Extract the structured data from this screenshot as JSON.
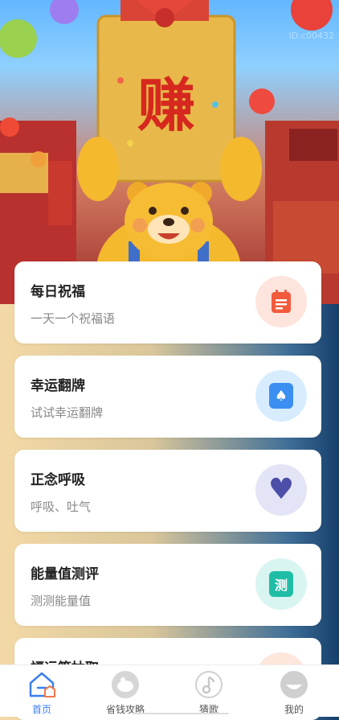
{
  "hero": {
    "banner_char": "赚",
    "watermark": "ID:c00432"
  },
  "cards": [
    {
      "title": "每日祝福",
      "subtitle": "一天一个祝福语",
      "icon": "note-icon",
      "icon_glyph": "",
      "bg": "#fde4dd",
      "fg": "#f15a3c"
    },
    {
      "title": "幸运翻牌",
      "subtitle": "试试幸运翻牌",
      "icon": "card-spade-icon",
      "icon_glyph": "♠",
      "bg": "#d7ecff",
      "fg": "#3b8ff0"
    },
    {
      "title": "正念呼吸",
      "subtitle": "呼吸、吐气",
      "icon": "heart-icon",
      "icon_glyph": "♥",
      "bg": "#e4e4f7",
      "fg": "#4c4fa8"
    },
    {
      "title": "能量值测评",
      "subtitle": "测测能量值",
      "icon": "test-icon",
      "icon_glyph": "测",
      "bg": "#d8f5f1",
      "fg": "#1fbda6"
    },
    {
      "title": "福运签抽取",
      "subtitle": "",
      "icon": "lot-icon",
      "icon_glyph": "",
      "bg": "#fde6dc",
      "fg": "#f07a4c"
    }
  ],
  "tabs": [
    {
      "label": "首页",
      "icon": "home-icon",
      "active": true
    },
    {
      "label": "省钱攻略",
      "icon": "piggy-bank-icon",
      "active": false
    },
    {
      "label": "猜歌",
      "icon": "music-note-icon",
      "active": false
    },
    {
      "label": "我的",
      "icon": "profile-icon",
      "active": false
    }
  ],
  "colors": {
    "active_tab": "#3b7ff0",
    "inactive_tab": "#555555"
  }
}
